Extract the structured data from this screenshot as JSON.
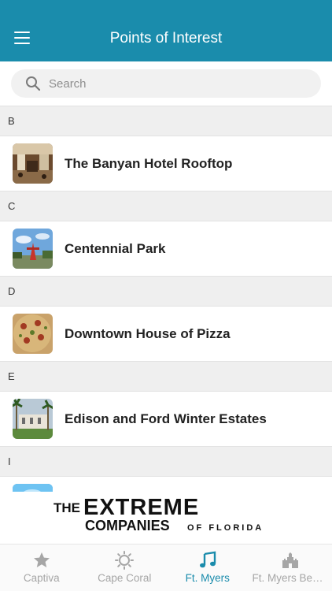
{
  "header": {
    "title": "Points of Interest"
  },
  "search": {
    "placeholder": "Search"
  },
  "sections": [
    {
      "letter": "B",
      "items": [
        {
          "label": "The Banyan Hotel Rooftop",
          "thumbnail": "restaurant-interior"
        }
      ]
    },
    {
      "letter": "C",
      "items": [
        {
          "label": "Centennial Park",
          "thumbnail": "park-sculpture"
        }
      ]
    },
    {
      "letter": "D",
      "items": [
        {
          "label": "Downtown House of Pizza",
          "thumbnail": "pizza"
        }
      ]
    },
    {
      "letter": "E",
      "items": [
        {
          "label": "Edison and Ford Winter Estates",
          "thumbnail": "estate-palms"
        }
      ]
    },
    {
      "letter": "I",
      "items": [
        {
          "label": "",
          "thumbnail": "water-blue"
        }
      ]
    }
  ],
  "banner": {
    "line1_prefix": "THE",
    "line1_brand": "EXTREME",
    "line2_main": "COMPANIES",
    "line2_suffix": "OF FLORIDA"
  },
  "tabs": [
    {
      "label": "Captiva",
      "icon": "star-icon",
      "active": false
    },
    {
      "label": "Cape Coral",
      "icon": "sun-icon",
      "active": false
    },
    {
      "label": "Ft. Myers",
      "icon": "music-note-icon",
      "active": true
    },
    {
      "label": "Ft. Myers Beach",
      "icon": "castle-icon",
      "active": false
    }
  ],
  "colors": {
    "primary": "#1a8cac",
    "inactive_tab": "#a6a6a6",
    "section_bg": "#efefef"
  }
}
